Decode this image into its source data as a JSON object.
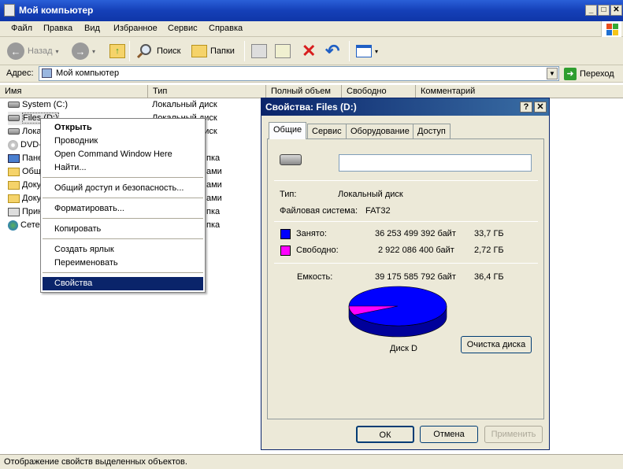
{
  "window": {
    "title": "Мой компьютер",
    "icon": "computer-icon",
    "btn_min": "_",
    "btn_max": "□",
    "btn_close": "✕"
  },
  "menu": [
    "Файл",
    "Правка",
    "Вид",
    "Избранное",
    "Сервис",
    "Справка"
  ],
  "toolbar": {
    "back": "Назад",
    "search": "Поиск",
    "folders": "Папки"
  },
  "address": {
    "label": "Адрес:",
    "value": "Мой компьютер",
    "go": "Переход"
  },
  "columns": [
    "Имя",
    "Тип",
    "Полный объем",
    "Свободно",
    "Комментарий"
  ],
  "items": [
    {
      "name": "System (C:)",
      "type": "Локальный диск",
      "icon": "drive"
    },
    {
      "name": "Files (D:)",
      "type": "Локальный диск",
      "icon": "drive"
    },
    {
      "name": "Лока",
      "type": "Локальный диск",
      "icon": "drive"
    },
    {
      "name": "DVD-",
      "type": "",
      "icon": "cd"
    },
    {
      "name": "Пане",
      "type": "Системная папка",
      "icon": "panel"
    },
    {
      "name": "Общ",
      "type": "Папка с файлами",
      "icon": "folder"
    },
    {
      "name": "Доку",
      "type": "Папка с файлами",
      "icon": "folder"
    },
    {
      "name": "Доку",
      "type": "Папка с файлами",
      "icon": "folder"
    },
    {
      "name": "Прин",
      "type": "Системная папка",
      "icon": "printer"
    },
    {
      "name": "Сете",
      "type": "Системная папка",
      "icon": "network"
    }
  ],
  "type_fragments": [
    "пка",
    "ами",
    "ами",
    "ами",
    "пка",
    "пка",
    "пка"
  ],
  "context_menu": {
    "open": "Открыть",
    "explorer": "Проводник",
    "cmd": "Open Command Window Here",
    "find": "Найти...",
    "sharing": "Общий доступ и безопасность...",
    "format": "Форматировать...",
    "copy": "Копировать",
    "shortcut": "Создать ярлык",
    "rename": "Переименовать",
    "properties": "Свойства"
  },
  "dialog": {
    "title": "Свойства: Files (D:)",
    "help": "?",
    "close": "✕",
    "tabs": [
      "Общие",
      "Сервис",
      "Оборудование",
      "Доступ"
    ],
    "label_value": "",
    "type_label": "Тип:",
    "type_value": "Локальный диск",
    "fs_label": "Файловая система:",
    "fs_value": "FAT32",
    "used_label": "Занято:",
    "used_bytes": "36 253 499 392 байт",
    "used_gb": "33,7 ГБ",
    "free_label": "Свободно:",
    "free_bytes": "2 922 086 400 байт",
    "free_gb": "2,72 ГБ",
    "cap_label": "Емкость:",
    "cap_bytes": "39 175 585 792 байт",
    "cap_gb": "36,4 ГБ",
    "disk_label": "Диск D",
    "cleanup": "Очистка диска",
    "ok": "ОК",
    "cancel": "Отмена",
    "apply": "Применить",
    "used_color": "#0000ff",
    "free_color": "#ff00ff",
    "free_fraction": 0.0746
  },
  "status": "Отображение свойств выделенных объектов."
}
